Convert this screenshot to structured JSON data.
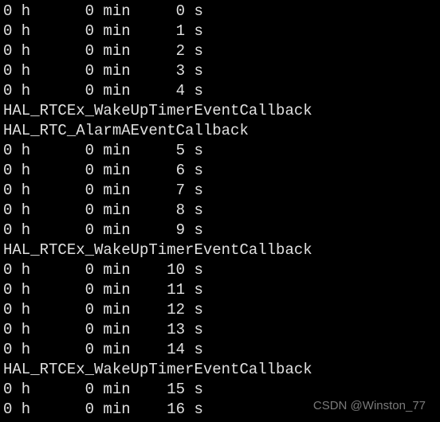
{
  "terminal": {
    "lines": [
      {
        "type": "time",
        "h": 0,
        "m": 0,
        "s": 0
      },
      {
        "type": "time",
        "h": 0,
        "m": 0,
        "s": 1
      },
      {
        "type": "time",
        "h": 0,
        "m": 0,
        "s": 2
      },
      {
        "type": "time",
        "h": 0,
        "m": 0,
        "s": 3
      },
      {
        "type": "time",
        "h": 0,
        "m": 0,
        "s": 4
      },
      {
        "type": "msg",
        "text": "HAL_RTCEx_WakeUpTimerEventCallback"
      },
      {
        "type": "msg",
        "text": "HAL_RTC_AlarmAEventCallback"
      },
      {
        "type": "time",
        "h": 0,
        "m": 0,
        "s": 5
      },
      {
        "type": "time",
        "h": 0,
        "m": 0,
        "s": 6
      },
      {
        "type": "time",
        "h": 0,
        "m": 0,
        "s": 7
      },
      {
        "type": "time",
        "h": 0,
        "m": 0,
        "s": 8
      },
      {
        "type": "time",
        "h": 0,
        "m": 0,
        "s": 9
      },
      {
        "type": "msg",
        "text": "HAL_RTCEx_WakeUpTimerEventCallback"
      },
      {
        "type": "time",
        "h": 0,
        "m": 0,
        "s": 10
      },
      {
        "type": "time",
        "h": 0,
        "m": 0,
        "s": 11
      },
      {
        "type": "time",
        "h": 0,
        "m": 0,
        "s": 12
      },
      {
        "type": "time",
        "h": 0,
        "m": 0,
        "s": 13
      },
      {
        "type": "time",
        "h": 0,
        "m": 0,
        "s": 14
      },
      {
        "type": "msg",
        "text": "HAL_RTCEx_WakeUpTimerEventCallback"
      },
      {
        "type": "time",
        "h": 0,
        "m": 0,
        "s": 15
      },
      {
        "type": "time",
        "h": 0,
        "m": 0,
        "s": 16
      }
    ]
  },
  "watermark": "CSDN @Winston_77"
}
